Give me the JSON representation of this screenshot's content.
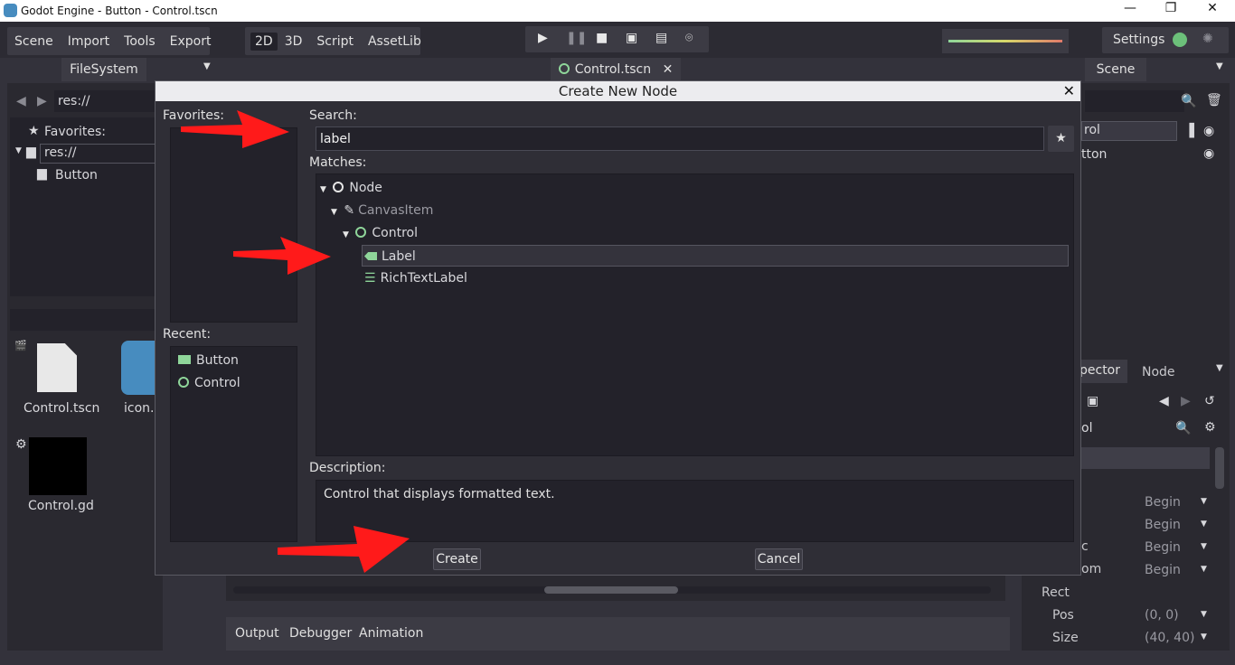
{
  "window": {
    "title": "Godot Engine - Button - Control.tscn",
    "minimize": "—",
    "restore": "❐",
    "close": "✕"
  },
  "menu": {
    "items": [
      "Scene",
      "Import",
      "Tools",
      "Export"
    ]
  },
  "workspaces": {
    "items": [
      "2D",
      "3D",
      "Script",
      "AssetLib"
    ],
    "active": "2D"
  },
  "playback": {
    "icons": [
      "play-icon",
      "pause-icon",
      "stop-icon",
      "play-scene-icon",
      "play-custom-icon",
      "remote-debug-icon"
    ]
  },
  "settings": {
    "label": "Settings"
  },
  "filesystem": {
    "tab": "FileSystem",
    "path": "res://",
    "favorites_label": "Favorites:",
    "root": "res://",
    "folder": "Button",
    "files": [
      {
        "name": "Control.tscn",
        "icon": "scene-file-icon"
      },
      {
        "name": "icon.p",
        "icon": "godot-icon"
      },
      {
        "name": "Control.gd",
        "icon": "script-file-icon"
      }
    ]
  },
  "scene_tab": {
    "label": "Control.tscn",
    "close": "✕"
  },
  "scene_dock": {
    "tab": "Scene",
    "nodes": [
      "rol",
      "tton"
    ]
  },
  "inspector": {
    "tabs": [
      "pector",
      "Node"
    ],
    "filter": "ol",
    "props": [
      {
        "name": "",
        "value": "Begin"
      },
      {
        "name": "",
        "value": "Begin"
      },
      {
        "name": "c",
        "value": "Begin"
      },
      {
        "name": "om",
        "value": "Begin"
      }
    ],
    "section": "Rect",
    "rect_props": [
      {
        "name": "Pos",
        "value": "(0, 0)"
      },
      {
        "name": "Size",
        "value": "(40, 40)"
      }
    ]
  },
  "bottom_panel": {
    "tabs": [
      "Output",
      "Debugger",
      "Animation"
    ]
  },
  "dialog": {
    "title": "Create New Node",
    "close": "✕",
    "favorites_label": "Favorites:",
    "recent_label": "Recent:",
    "recent": [
      {
        "label": "Button",
        "icon": "button-node-icon"
      },
      {
        "label": "Control",
        "icon": "control-node-icon"
      }
    ],
    "search_label": "Search:",
    "search_value": "label",
    "matches_label": "Matches:",
    "tree": [
      {
        "label": "Node",
        "level": 0,
        "icon": "node-icon"
      },
      {
        "label": "CanvasItem",
        "level": 1,
        "icon": "canvasitem-icon"
      },
      {
        "label": "Control",
        "level": 2,
        "icon": "control-node-icon"
      },
      {
        "label": "Label",
        "level": 3,
        "icon": "label-node-icon",
        "selected": true
      },
      {
        "label": "RichTextLabel",
        "level": 3,
        "icon": "richtextlabel-icon"
      }
    ],
    "description_label": "Description:",
    "description": "Control that displays formatted text.",
    "create_button": "Create",
    "cancel_button": "Cancel"
  },
  "colors": {
    "accent_green": "#8fd69a",
    "annotation_red": "#ff1a1a",
    "panel_bg": "#2a2930"
  }
}
